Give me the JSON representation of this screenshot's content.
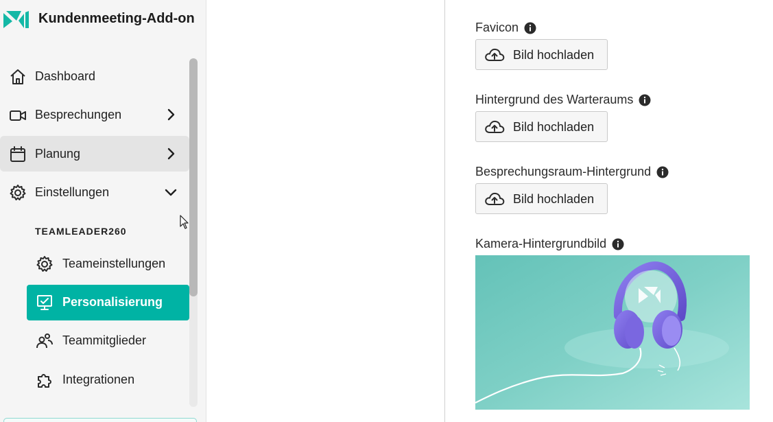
{
  "app": {
    "title": "Kundenmeeting-Add-on"
  },
  "colors": {
    "accent": "#00b3a4",
    "logo": "#14b8a6",
    "image_bg": "#6cc6bd",
    "headphones": "#7b67d9"
  },
  "sidebar": {
    "items": [
      {
        "label": "Dashboard",
        "icon": "home-icon"
      },
      {
        "label": "Besprechungen",
        "icon": "video-camera-icon",
        "chevron": "chevron-right-icon"
      },
      {
        "label": "Planung",
        "icon": "calendar-icon",
        "chevron": "chevron-right-icon"
      },
      {
        "label": "Einstellungen",
        "icon": "gear-icon",
        "chevron": "chevron-down-icon"
      }
    ],
    "section": "TEAMLEADER260",
    "subitems": [
      {
        "label": "Teameinstellungen",
        "icon": "gear-icon"
      },
      {
        "label": "Personalisierung",
        "icon": "monitor-check-icon",
        "selected": true
      },
      {
        "label": "Teammitglieder",
        "icon": "users-icon"
      },
      {
        "label": "Integrationen",
        "icon": "puzzle-icon"
      }
    ]
  },
  "main": {
    "fields": [
      {
        "label": "Favicon",
        "button": "Bild hochladen"
      },
      {
        "label": "Hintergrund des Warteraums",
        "button": "Bild hochladen"
      },
      {
        "label": "Besprechungsraum-Hintergrund",
        "button": "Bild hochladen"
      },
      {
        "label": "Kamera-Hintergrundbild"
      }
    ]
  }
}
